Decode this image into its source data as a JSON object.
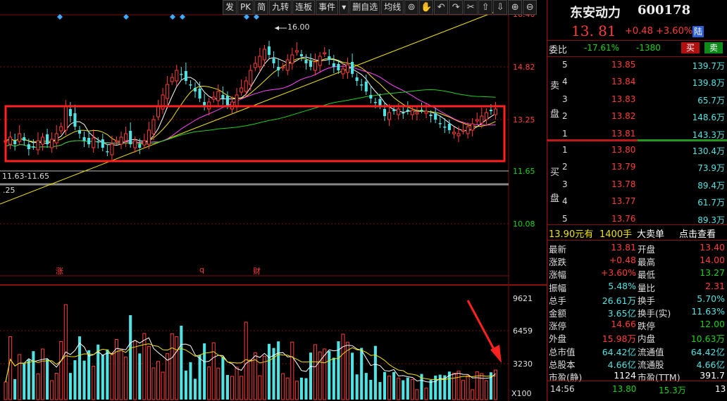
{
  "toolbar": {
    "buttons": [
      "发",
      "PK",
      "简",
      "九转",
      "连板",
      "事件",
      "▾",
      "删自选",
      "均线"
    ],
    "icons": [
      "binoculars-icon",
      "hand-icon",
      "undo-icon",
      "redo-icon",
      "scissors-icon",
      "up-arrow-icon",
      "down-arrow-icon",
      "zoom-in-icon",
      "zoom-out-icon"
    ],
    "icon_glyphs": [
      "⊚",
      "✋",
      "↶",
      "↷",
      "✂",
      "⇧",
      "⇩",
      "⊕",
      "⊖"
    ]
  },
  "price_axis": [
    "16.40",
    "14.82",
    "13.25",
    "11.65",
    "10.08"
  ],
  "volume_axis": [
    "9621",
    "6459",
    "3230",
    "X100"
  ],
  "annotations": {
    "high_marker": "16.00",
    "low_marker": "11.63-11.65",
    "left_value": ".25",
    "event_markers": [
      "涨",
      "q",
      "财"
    ]
  },
  "colors": {
    "up": "#ff3c3c",
    "down": "#4fe3e3",
    "box": "#ff2020",
    "trend": "#f1e300"
  },
  "quote": {
    "name": "东安动力",
    "code": "600178",
    "price": "13. 81",
    "change": "+0.48",
    "change_pct": "+3.60%",
    "badge": "陆"
  },
  "weibi": {
    "label": "委比",
    "ratio": "-17.61%",
    "diff": "-1380",
    "buy_btn": "买",
    "sell_btn": "卖"
  },
  "sell_label": [
    "卖",
    "盘"
  ],
  "buy_label": [
    "买",
    "盘"
  ],
  "sell_orders": [
    {
      "level": "5",
      "price": "13.85",
      "vol": "139.7万"
    },
    {
      "level": "4",
      "price": "13.84",
      "vol": "139.8万"
    },
    {
      "level": "3",
      "price": "13.83",
      "vol": "65.7万"
    },
    {
      "level": "2",
      "price": "13.82",
      "vol": "148.6万"
    },
    {
      "level": "1",
      "price": "13.81",
      "vol": "143.3万"
    }
  ],
  "buy_orders": [
    {
      "level": "1",
      "price": "13.80",
      "vol": "130.4万"
    },
    {
      "level": "2",
      "price": "13.79",
      "vol": "73.9万"
    },
    {
      "level": "3",
      "price": "13.78",
      "vol": "89.4万"
    },
    {
      "level": "4",
      "price": "13.77",
      "vol": "61.7万"
    },
    {
      "level": "5",
      "price": "13.76",
      "vol": "89.3万"
    }
  ],
  "big_order": {
    "price": "13.90元有",
    "qty": "1400手",
    "label": "大卖单",
    "link": "点击查看"
  },
  "stats": [
    [
      "最新",
      "13.81",
      "开盘",
      "13.40"
    ],
    [
      "涨跌",
      "+0.48",
      "最高",
      "14.00"
    ],
    [
      "涨幅",
      "+3.60%",
      "最低",
      "13.27"
    ],
    [
      "振幅",
      "5.48%",
      "量比",
      "2.31"
    ],
    [
      "总手",
      "26.61万",
      "换手",
      "5.70%"
    ],
    [
      "金额",
      "3.65亿",
      "换手(实)",
      "11.63%"
    ],
    [
      "涨停",
      "14.66",
      "跌停",
      "12.00"
    ],
    [
      "外盘",
      "15.98万",
      "内盘",
      "10.63万"
    ],
    [
      "总市值",
      "64.42亿",
      "流通值",
      "64.42亿"
    ],
    [
      "总股本",
      "4.66亿",
      "流通股",
      "4.66亿"
    ],
    [
      "市盈(静)",
      "1124",
      "市盈(TTM)",
      "391.7"
    ]
  ],
  "tick": {
    "time": "14:56",
    "price": "13.80",
    "vol": "15.3万",
    "extra": "13"
  }
}
